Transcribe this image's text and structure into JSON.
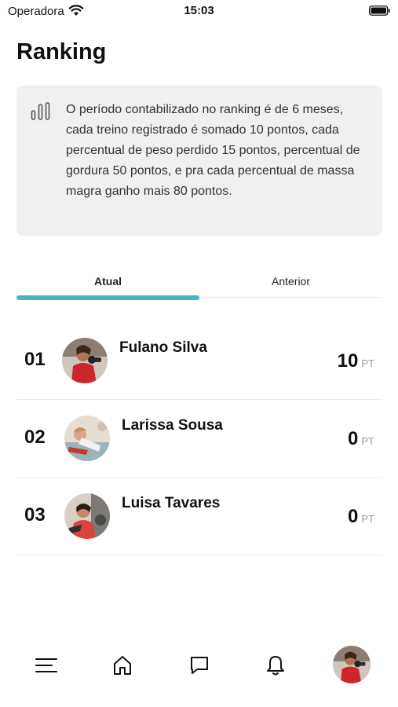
{
  "status_bar": {
    "carrier": "Operadora",
    "time": "15:03"
  },
  "page": {
    "title": "Ranking"
  },
  "info": {
    "icon": "bar-chart-icon",
    "text": "O período contabilizado no ranking é de 6 meses, cada treino registrado é somado 10 pontos, cada percentual de peso perdido 15 pontos, percentual de gordura 50 pontos, e pra cada percentual de massa magra ganho mais 80 pontos."
  },
  "tabs": [
    {
      "label": "Atual",
      "active": true
    },
    {
      "label": "Anterior",
      "active": false
    }
  ],
  "colors": {
    "accent": "#4bb3c4",
    "info_bg": "#f0f0f0"
  },
  "ranking": [
    {
      "position": "01",
      "name": "Fulano Silva",
      "points": "10",
      "unit": "PT"
    },
    {
      "position": "02",
      "name": "Larissa Sousa",
      "points": "0",
      "unit": "PT"
    },
    {
      "position": "03",
      "name": "Luisa Tavares",
      "points": "0",
      "unit": "PT"
    }
  ],
  "bottom_nav": [
    {
      "icon": "menu-icon"
    },
    {
      "icon": "home-icon"
    },
    {
      "icon": "chat-icon"
    },
    {
      "icon": "bell-icon"
    },
    {
      "icon": "profile-avatar"
    }
  ]
}
